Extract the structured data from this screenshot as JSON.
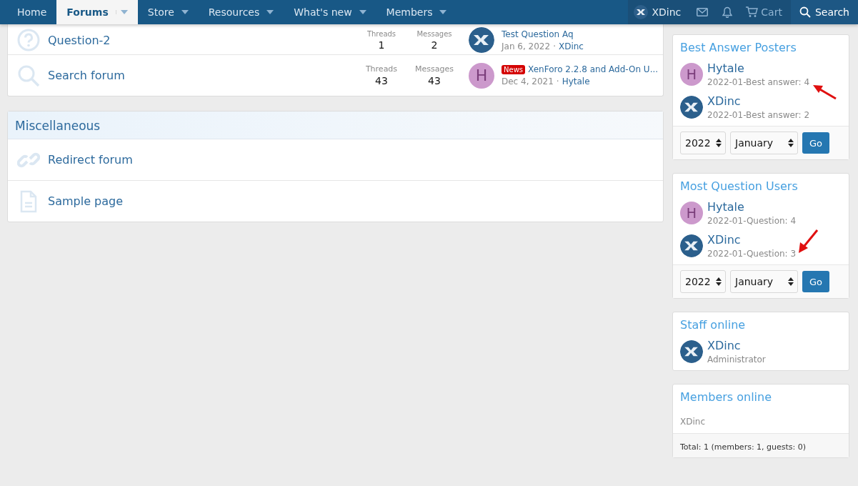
{
  "nav": {
    "items": [
      {
        "label": "Home",
        "selected": false,
        "dropdown": false
      },
      {
        "label": "Forums",
        "selected": true,
        "dropdown": true
      },
      {
        "label": "Store",
        "selected": false,
        "dropdown": true
      },
      {
        "label": "Resources",
        "selected": false,
        "dropdown": true
      },
      {
        "label": "What's new",
        "selected": false,
        "dropdown": true
      },
      {
        "label": "Members",
        "selected": false,
        "dropdown": true
      }
    ],
    "user": "XDinc",
    "cart": "Cart",
    "search": "Search"
  },
  "forum_sections": [
    {
      "rows": [
        {
          "kind": "question",
          "title": "Question-2",
          "stats": [
            {
              "label": "Threads",
              "value": "1"
            },
            {
              "label": "Messages",
              "value": "2"
            }
          ],
          "last_post": {
            "avatar": {
              "kind": "logo"
            },
            "title": "Test Question Aq",
            "date": "Jan 6, 2022",
            "separator": "·",
            "user": "XDinc"
          }
        },
        {
          "kind": "search",
          "title": "Search forum",
          "stats": [
            {
              "label": "Threads",
              "value": "43"
            },
            {
              "label": "Messages",
              "value": "43"
            }
          ],
          "last_post": {
            "avatar": {
              "kind": "letter",
              "letter": "H"
            },
            "prefix": "News",
            "title": "XenForo 2.2.8 and Add-On U...",
            "date": "Dec 4, 2021",
            "separator": "·",
            "user": "Hytale"
          }
        }
      ]
    },
    {
      "title": "Miscellaneous",
      "rows": [
        {
          "kind": "link",
          "title": "Redirect forum"
        },
        {
          "kind": "page",
          "title": "Sample page"
        }
      ]
    }
  ],
  "sidebar": [
    {
      "kind": "ranking",
      "title": "Best Answer Posters",
      "users": [
        {
          "name": "Hytale",
          "avatar": {
            "kind": "letter",
            "letter": "H"
          },
          "detail": "2022-01-Best answer: 4",
          "arrow": {
            "kind": "up"
          }
        },
        {
          "name": "XDinc",
          "avatar": {
            "kind": "logo"
          },
          "detail": "2022-01-Best answer: 2"
        }
      ],
      "year": "2022",
      "month": "January",
      "button": "Go"
    },
    {
      "kind": "ranking",
      "title": "Most Question Users",
      "users": [
        {
          "name": "Hytale",
          "avatar": {
            "kind": "letter",
            "letter": "H"
          },
          "detail": "2022-01-Question: 4"
        },
        {
          "name": "XDinc",
          "avatar": {
            "kind": "logo"
          },
          "detail": "2022-01-Question: 3",
          "arrow": {
            "kind": "down"
          }
        }
      ],
      "year": "2022",
      "month": "January",
      "button": "Go"
    },
    {
      "kind": "staff",
      "title": "Staff online",
      "users": [
        {
          "name": "XDinc",
          "avatar": {
            "kind": "logo"
          },
          "detail": "Administrator"
        }
      ]
    },
    {
      "kind": "members",
      "title": "Members online",
      "members": [
        "XDinc"
      ],
      "footer": "Total: 1 (members: 1, guests: 0)"
    }
  ]
}
